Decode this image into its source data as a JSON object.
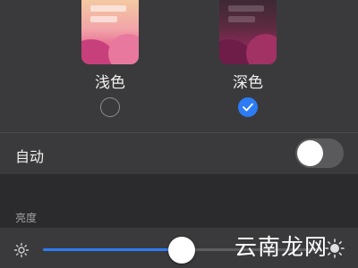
{
  "appearance": {
    "light_label": "浅色",
    "dark_label": "深色",
    "selected": "dark"
  },
  "auto": {
    "label": "自动",
    "enabled": false
  },
  "brightness": {
    "section_label": "亮度",
    "level": 0.5
  },
  "watermark": {
    "text": "云南龙网"
  },
  "colors": {
    "accent": "#2d7cf6",
    "background": "#2b2b2d",
    "card": "#3a3a3c"
  }
}
